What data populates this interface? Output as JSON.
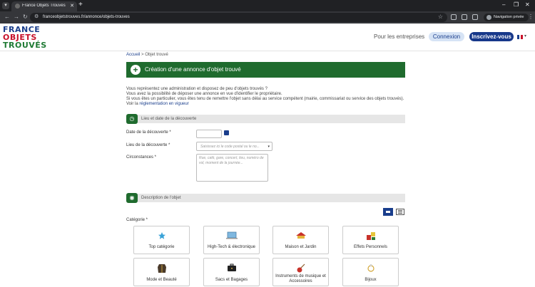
{
  "browser": {
    "tab_title": "France Objets Trouvés – objets trouvés",
    "new_tab": "+",
    "url": "franceobjetstrouves.fr/annonce/objets-trouves",
    "private_label": "Navigation privée",
    "window_controls": [
      "–",
      "❐",
      "✕"
    ]
  },
  "header": {
    "logo": [
      "FRANCE",
      "OBJETS",
      "TROUVÉS"
    ],
    "pro_link": "Pour les entreprises",
    "login": "Connexion",
    "signup": "Inscrivez-vous",
    "colors": {
      "brand_blue": "#1a3e8c",
      "brand_red": "#c8112a",
      "brand_green": "#1f7a34"
    }
  },
  "breadcrumb": {
    "home": "Accueil",
    "sep": " > ",
    "current": "Objet trouvé"
  },
  "banner": {
    "plus": "+",
    "title": "Création d'une annonce d'objet trouvé",
    "color": "#1f6b2e"
  },
  "intro": {
    "line1": "Vous représentez une administration et disposez de peu d'objets trouvés ?",
    "line2": "Vous avez la possibilité de déposer une annonce en vue d'identifier le propriétaire.",
    "line3": "Si vous êtes un particulier, vous êtes tenu de remettre l'objet sans délai au service compétent (mairie, commissariat ou service des objets trouvés).",
    "line4_prefix": "Voir la ",
    "line4_link": "réglementation en vigueur"
  },
  "section_discovery": {
    "title": "Lieu et date de la découverte",
    "date_label": "Date de la découverte *",
    "place_label": "Lieu de la découverte *",
    "place_placeholder": "Saisissez ici le code postal ou le no...",
    "circ_label": "Circonstances *",
    "circ_placeholder": "Rue, café, gare, concert, lieu, numéro de vol, moment de la journée..."
  },
  "section_description": {
    "title": "Description de l'objet",
    "category_label": "Catégorie *",
    "categories": [
      "Top catégorie",
      "High-Tech & électronique",
      "Maison et Jardin",
      "Effets Personnels",
      "Mode et Beauté",
      "Sacs et Bagages",
      "Instruments de musique et Accessoires",
      "Bijoux"
    ]
  }
}
